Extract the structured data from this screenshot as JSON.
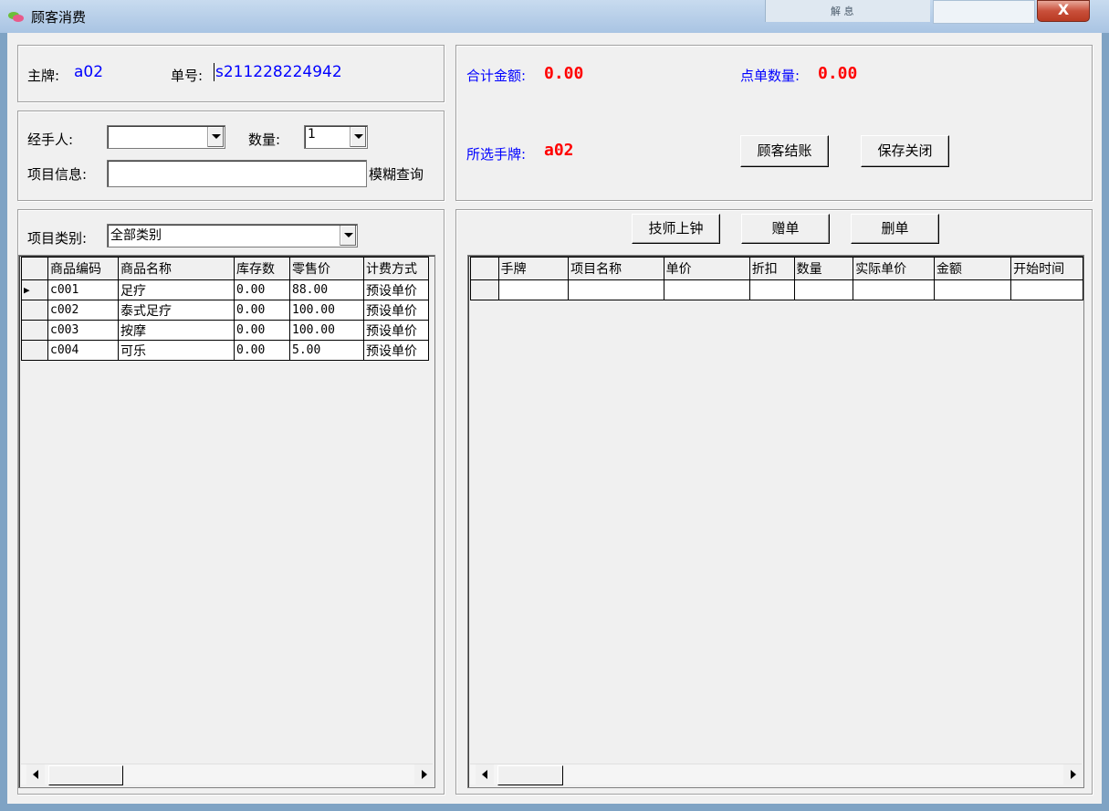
{
  "window": {
    "title": "顾客消费",
    "close_label": "X",
    "behind_text": "解 息"
  },
  "header": {
    "main_tag_label": "主牌:",
    "main_tag_value": "a02",
    "order_no_label": "单号:",
    "order_no_value": "s211228224942"
  },
  "summary": {
    "total_amount_label": "合计金额:",
    "total_amount_value": "0.00",
    "order_qty_label": "点单数量:",
    "order_qty_value": "0.00",
    "selected_tag_label": "所选手牌:",
    "selected_tag_value": "a02",
    "checkout_button": "顾客结账",
    "save_close_button": "保存关闭"
  },
  "form": {
    "handler_label": "经手人:",
    "handler_value": "",
    "quantity_label": "数量:",
    "quantity_value": "1",
    "item_info_label": "项目信息:",
    "item_info_value": "",
    "fuzzy_search_label": "模糊查询"
  },
  "catalog": {
    "category_label": "项目类别:",
    "category_value": "全部类别",
    "columns": [
      "商品编码",
      "商品名称",
      "库存数",
      "零售价",
      "计费方式"
    ],
    "rows": [
      {
        "code": "c001",
        "name": "足疗",
        "stock": "0.00",
        "price": "88.00",
        "billing": "预设单价"
      },
      {
        "code": "c002",
        "name": "泰式足疗",
        "stock": "0.00",
        "price": "100.00",
        "billing": "预设单价"
      },
      {
        "code": "c003",
        "name": "按摩",
        "stock": "0.00",
        "price": "100.00",
        "billing": "预设单价"
      },
      {
        "code": "c004",
        "name": "可乐",
        "stock": "0.00",
        "price": "5.00",
        "billing": "预设单价"
      }
    ]
  },
  "order": {
    "tech_start_button": "技师上钟",
    "gift_button": "赠单",
    "delete_button": "删单",
    "columns": [
      "手牌",
      "项目名称",
      "单价",
      "折扣",
      "数量",
      "实际单价",
      "金额",
      "开始时间"
    ]
  },
  "colors": {
    "label_blue": "#0000ff",
    "value_red": "#ff0000",
    "face": "#f0f0f0"
  }
}
